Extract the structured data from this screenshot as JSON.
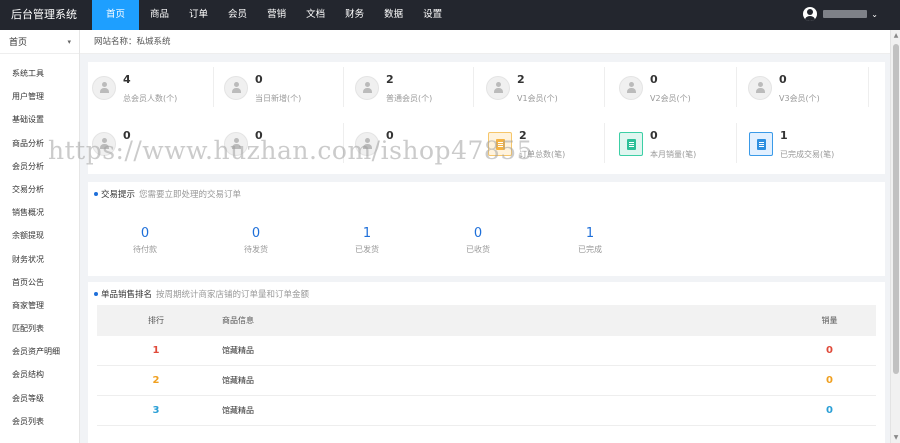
{
  "brand": "后台管理系统",
  "nav": [
    "首页",
    "商品",
    "订单",
    "会员",
    "营销",
    "文档",
    "财务",
    "数据",
    "设置"
  ],
  "user": {
    "caret": "⌄"
  },
  "sidebar": {
    "select": "首页",
    "select_arrow": "▾",
    "items": [
      "系统工具",
      "用户管理",
      "基础设置",
      "商品分析",
      "会员分析",
      "交易分析",
      "销售概况",
      "余额提现",
      "财务状况",
      "首页公告",
      "商家管理",
      "匹配列表",
      "会员资产明细",
      "会员结构",
      "会员等级",
      "会员列表"
    ]
  },
  "crumb": "网站名称：私城系统",
  "stats": [
    {
      "value": "4",
      "label": "总会员人数(个)",
      "icon": "user-icon"
    },
    {
      "value": "0",
      "label": "当日新增(个)",
      "icon": "user-icon"
    },
    {
      "value": "2",
      "label": "普通会员(个)",
      "icon": "user-icon"
    },
    {
      "value": "2",
      "label": "V1会员(个)",
      "icon": "user-icon"
    },
    {
      "value": "0",
      "label": "V2会员(个)",
      "icon": "user-icon"
    },
    {
      "value": "0",
      "label": "V3会员(个)",
      "icon": "user-icon"
    },
    {
      "value": "0",
      "label": "",
      "icon": "user-icon"
    },
    {
      "value": "0",
      "label": "",
      "icon": "user-icon"
    },
    {
      "value": "0",
      "label": "",
      "icon": "user-icon"
    },
    {
      "value": "2",
      "label": "订单总数(笔)",
      "icon": "order-icon",
      "color": "#f5b342"
    },
    {
      "value": "0",
      "label": "本月销量(笔)",
      "icon": "clipboard-icon",
      "color": "#2cc098"
    },
    {
      "value": "1",
      "label": "已完成交易(笔)",
      "icon": "calendar-icon",
      "color": "#2d8fe0"
    }
  ],
  "trade": {
    "title": "交易提示",
    "subtitle": "您需要立即处理的交易订单",
    "items": [
      {
        "value": "0",
        "label": "待付款"
      },
      {
        "value": "0",
        "label": "待发货"
      },
      {
        "value": "1",
        "label": "已发货"
      },
      {
        "value": "0",
        "label": "已收货"
      },
      {
        "value": "1",
        "label": "已完成"
      }
    ]
  },
  "ranking": {
    "title": "单品销售排名",
    "subtitle": "按周期统计商家店铺的订单量和订单金额",
    "headers": {
      "rank": "排行",
      "name": "商品信息",
      "sales": "销量"
    },
    "rows": [
      {
        "rank": "1",
        "name": "馆藏精品",
        "sales": "0",
        "color": "#e04a3a"
      },
      {
        "rank": "2",
        "name": "馆藏精品",
        "sales": "0",
        "color": "#f0a020"
      },
      {
        "rank": "3",
        "name": "馆藏精品",
        "sales": "0",
        "color": "#2a9fd6"
      }
    ]
  },
  "watermark": "https://www.huzhan.com/ishop47855",
  "colors": {
    "topbar": "#23262e",
    "accent": "#1e9fff",
    "link": "#1e6fd9"
  }
}
